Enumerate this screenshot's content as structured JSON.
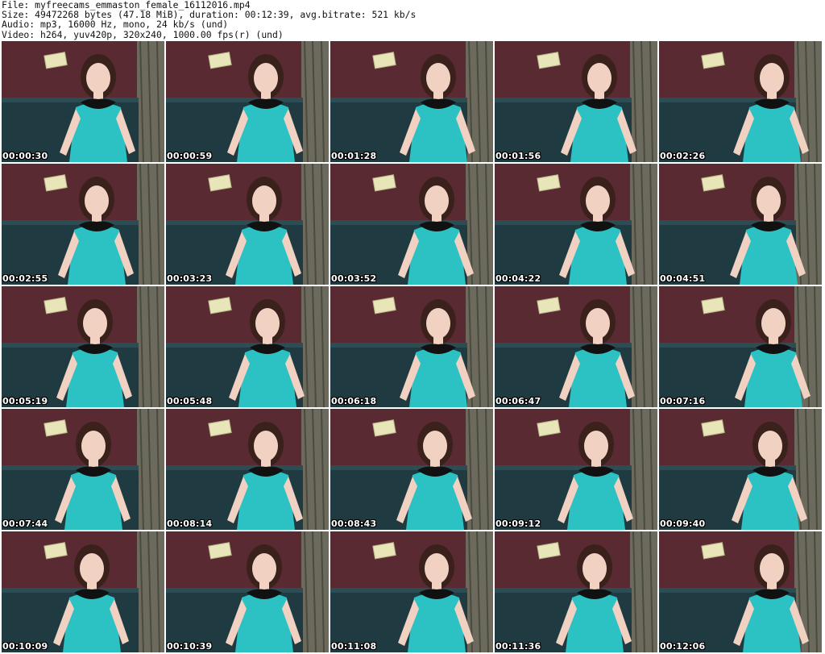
{
  "header": {
    "file": "File: myfreecams_emmaston_female_16112016.mp4",
    "size": "Size: 49472268 bytes (47.18 MiB), duration: 00:12:39, avg.bitrate: 521 kb/s",
    "audio": "Audio: mp3, 16000 Hz, mono, 24 kb/s (und)",
    "video": "Video: h264, yuv420p, 320x240, 1000.00 fps(r) (und)"
  },
  "thumbnails": [
    {
      "time": "00:00:30"
    },
    {
      "time": "00:00:59"
    },
    {
      "time": "00:01:28"
    },
    {
      "time": "00:01:56"
    },
    {
      "time": "00:02:26"
    },
    {
      "time": "00:02:55"
    },
    {
      "time": "00:03:23"
    },
    {
      "time": "00:03:52"
    },
    {
      "time": "00:04:22"
    },
    {
      "time": "00:04:51"
    },
    {
      "time": "00:05:19"
    },
    {
      "time": "00:05:48"
    },
    {
      "time": "00:06:18"
    },
    {
      "time": "00:06:47"
    },
    {
      "time": "00:07:16"
    },
    {
      "time": "00:07:44"
    },
    {
      "time": "00:08:14"
    },
    {
      "time": "00:08:43"
    },
    {
      "time": "00:09:12"
    },
    {
      "time": "00:09:40"
    },
    {
      "time": "00:10:09"
    },
    {
      "time": "00:10:39"
    },
    {
      "time": "00:11:08"
    },
    {
      "time": "00:11:36"
    },
    {
      "time": "00:12:06"
    }
  ],
  "colors": {
    "wall": "#5a2a33",
    "couch": "#1f3a40",
    "curtain": "#6b6a5c",
    "top": "#2cc2c4",
    "collar": "#111111",
    "skin": "#f1d2c2",
    "hair": "#3a211b",
    "picture": "#e8e6b8"
  }
}
